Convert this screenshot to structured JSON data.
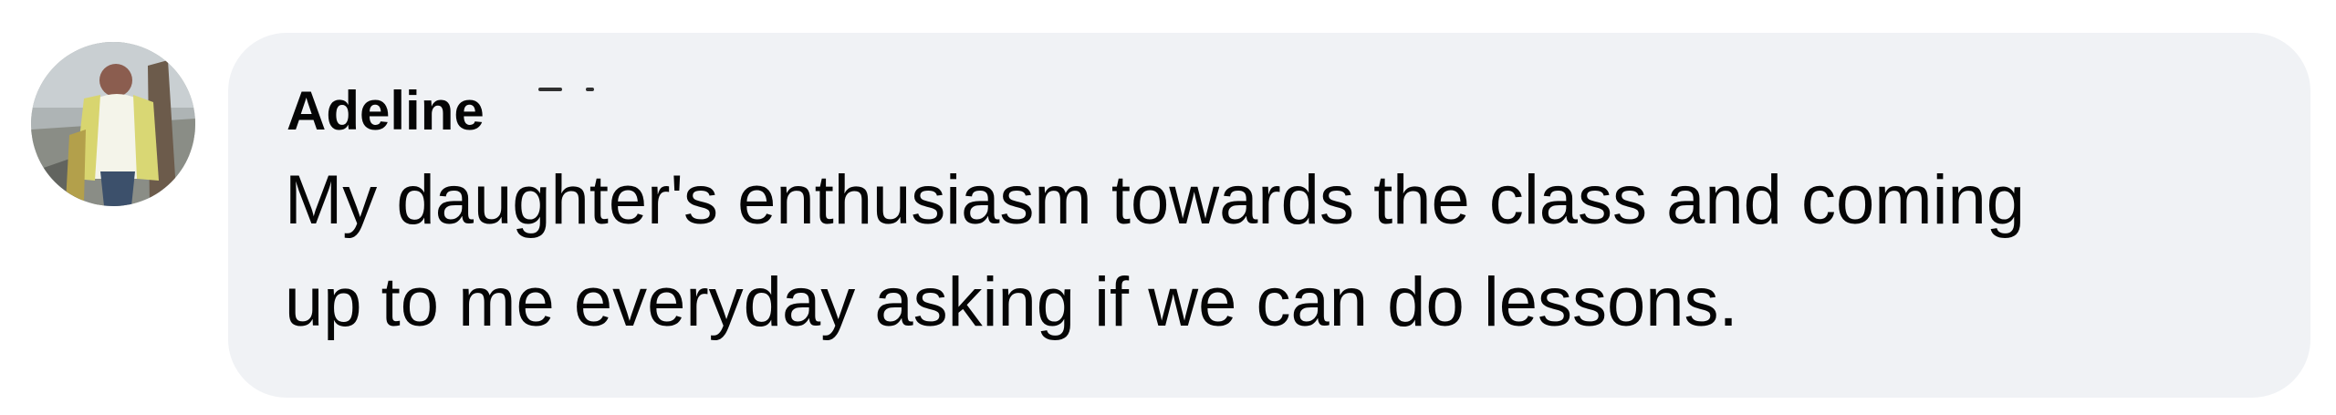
{
  "comment": {
    "author": "Adeline",
    "author_redacted": true,
    "text_lines": [
      "My daughter's enthusiasm towards the class and coming",
      "up to me everyday asking if we can do lessons."
    ]
  },
  "colors": {
    "bubble_background": "#f0f2f5",
    "text": "#050505",
    "page_background": "#ffffff"
  },
  "icons": {
    "avatar": "avatar-photo"
  }
}
